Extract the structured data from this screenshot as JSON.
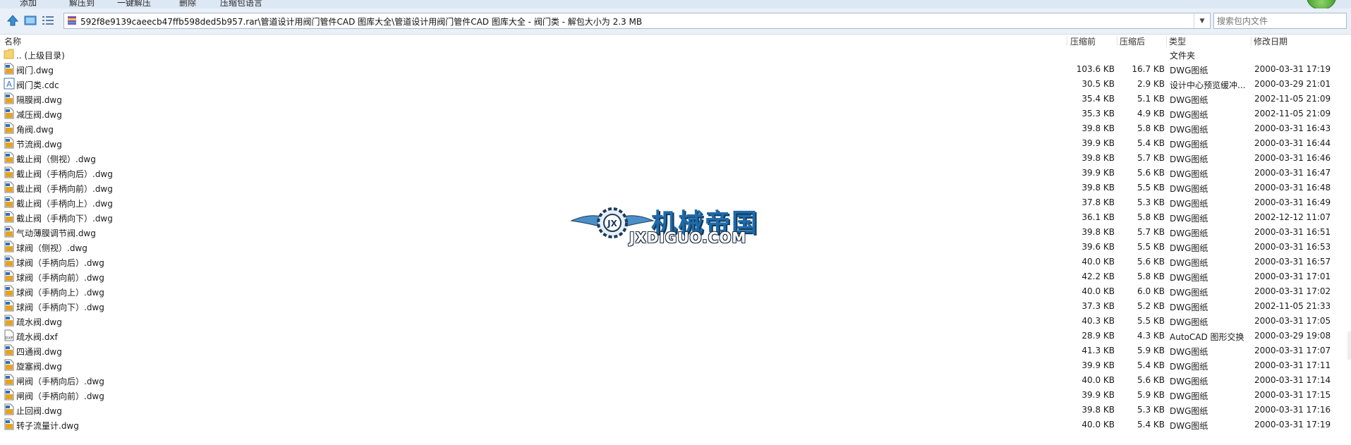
{
  "toolbar": {
    "items": [
      "添加",
      "解压到",
      "一键解压",
      "删除",
      "压缩包语言"
    ]
  },
  "address": {
    "path": "592f8e9139caeecb47ffb598ded5b957.rar\\管道设计用阀门管件CAD 图库大全\\管道设计用阀门管件CAD 图库大全 - 阀门类 - 解包大小为 2.3 MB"
  },
  "search": {
    "placeholder": "搜索包内文件"
  },
  "columns": {
    "name": "名称",
    "compressed_before": "压缩前",
    "compressed_after": "压缩后",
    "type": "类型",
    "modified": "修改日期"
  },
  "rows": [
    {
      "name": ".. (上级目录)",
      "icon": "folder-icon",
      "before": "",
      "after": "",
      "type": "文件夹",
      "date": ""
    },
    {
      "name": "阀门.dwg",
      "icon": "dwg-file-icon",
      "before": "103.6 KB",
      "after": "16.7 KB",
      "type": "DWG图纸",
      "date": "2000-03-31 17:19"
    },
    {
      "name": "阀门类.cdc",
      "icon": "cdc-file-icon",
      "before": "30.5 KB",
      "after": "2.9 KB",
      "type": "设计中心预览缓冲...",
      "date": "2000-03-29 21:01"
    },
    {
      "name": "隔膜阀.dwg",
      "icon": "dwg-file-icon",
      "before": "35.4 KB",
      "after": "5.1 KB",
      "type": "DWG图纸",
      "date": "2002-11-05 21:09"
    },
    {
      "name": "减压阀.dwg",
      "icon": "dwg-file-icon",
      "before": "35.3 KB",
      "after": "4.9 KB",
      "type": "DWG图纸",
      "date": "2002-11-05 21:09"
    },
    {
      "name": "角阀.dwg",
      "icon": "dwg-file-icon",
      "before": "39.8 KB",
      "after": "5.8 KB",
      "type": "DWG图纸",
      "date": "2000-03-31 16:43"
    },
    {
      "name": "节流阀.dwg",
      "icon": "dwg-file-icon",
      "before": "39.9 KB",
      "after": "5.4 KB",
      "type": "DWG图纸",
      "date": "2000-03-31 16:44"
    },
    {
      "name": "截止阀（侧视）.dwg",
      "icon": "dwg-file-icon",
      "before": "39.8 KB",
      "after": "5.7 KB",
      "type": "DWG图纸",
      "date": "2000-03-31 16:46"
    },
    {
      "name": "截止阀（手柄向后）.dwg",
      "icon": "dwg-file-icon",
      "before": "39.9 KB",
      "after": "5.6 KB",
      "type": "DWG图纸",
      "date": "2000-03-31 16:47"
    },
    {
      "name": "截止阀（手柄向前）.dwg",
      "icon": "dwg-file-icon",
      "before": "39.8 KB",
      "after": "5.5 KB",
      "type": "DWG图纸",
      "date": "2000-03-31 16:48"
    },
    {
      "name": "截止阀（手柄向上）.dwg",
      "icon": "dwg-file-icon",
      "before": "37.8 KB",
      "after": "5.3 KB",
      "type": "DWG图纸",
      "date": "2000-03-31 16:49"
    },
    {
      "name": "截止阀（手柄向下）.dwg",
      "icon": "dwg-file-icon",
      "before": "36.1 KB",
      "after": "5.8 KB",
      "type": "DWG图纸",
      "date": "2002-12-12 11:07"
    },
    {
      "name": "气动薄膜调节阀.dwg",
      "icon": "dwg-file-icon",
      "before": "39.8 KB",
      "after": "5.7 KB",
      "type": "DWG图纸",
      "date": "2000-03-31 16:51"
    },
    {
      "name": "球阀（侧视）.dwg",
      "icon": "dwg-file-icon",
      "before": "39.6 KB",
      "after": "5.5 KB",
      "type": "DWG图纸",
      "date": "2000-03-31 16:53"
    },
    {
      "name": "球阀（手柄向后）.dwg",
      "icon": "dwg-file-icon",
      "before": "40.0 KB",
      "after": "5.6 KB",
      "type": "DWG图纸",
      "date": "2000-03-31 16:57"
    },
    {
      "name": "球阀（手柄向前）.dwg",
      "icon": "dwg-file-icon",
      "before": "42.2 KB",
      "after": "5.8 KB",
      "type": "DWG图纸",
      "date": "2000-03-31 17:01"
    },
    {
      "name": "球阀（手柄向上）.dwg",
      "icon": "dwg-file-icon",
      "before": "40.0 KB",
      "after": "6.0 KB",
      "type": "DWG图纸",
      "date": "2000-03-31 17:02"
    },
    {
      "name": "球阀（手柄向下）.dwg",
      "icon": "dwg-file-icon",
      "before": "37.3 KB",
      "after": "5.2 KB",
      "type": "DWG图纸",
      "date": "2002-11-05 21:33"
    },
    {
      "name": "疏水阀.dwg",
      "icon": "dwg-file-icon",
      "before": "40.3 KB",
      "after": "5.5 KB",
      "type": "DWG图纸",
      "date": "2000-03-31 17:05"
    },
    {
      "name": "疏水阀.dxf",
      "icon": "dxf-file-icon",
      "before": "28.9 KB",
      "after": "4.3 KB",
      "type": "AutoCAD 图形交换",
      "date": "2000-03-29 19:08"
    },
    {
      "name": "四通阀.dwg",
      "icon": "dwg-file-icon",
      "before": "41.3 KB",
      "after": "5.9 KB",
      "type": "DWG图纸",
      "date": "2000-03-31 17:07"
    },
    {
      "name": "旋塞阀.dwg",
      "icon": "dwg-file-icon",
      "before": "39.9 KB",
      "after": "5.4 KB",
      "type": "DWG图纸",
      "date": "2000-03-31 17:11"
    },
    {
      "name": "闸阀（手柄向后）.dwg",
      "icon": "dwg-file-icon",
      "before": "40.0 KB",
      "after": "5.6 KB",
      "type": "DWG图纸",
      "date": "2000-03-31 17:14"
    },
    {
      "name": "闸阀（手柄向前）.dwg",
      "icon": "dwg-file-icon",
      "before": "39.9 KB",
      "after": "5.9 KB",
      "type": "DWG图纸",
      "date": "2000-03-31 17:15"
    },
    {
      "name": "止回阀.dwg",
      "icon": "dwg-file-icon",
      "before": "39.8 KB",
      "after": "5.3 KB",
      "type": "DWG图纸",
      "date": "2000-03-31 17:16"
    },
    {
      "name": "转子流量计.dwg",
      "icon": "dwg-file-icon",
      "before": "40.0 KB",
      "after": "5.4 KB",
      "type": "DWG图纸",
      "date": "2000-03-31 17:19"
    }
  ],
  "watermark": {
    "cn": "机械帝国",
    "en": "JXDIGUO.COM"
  },
  "colors": {
    "toolbar_bg": "#dde8f5",
    "address_bg": "#e9f0f8",
    "watermark_blue": "#1f6aa8"
  }
}
